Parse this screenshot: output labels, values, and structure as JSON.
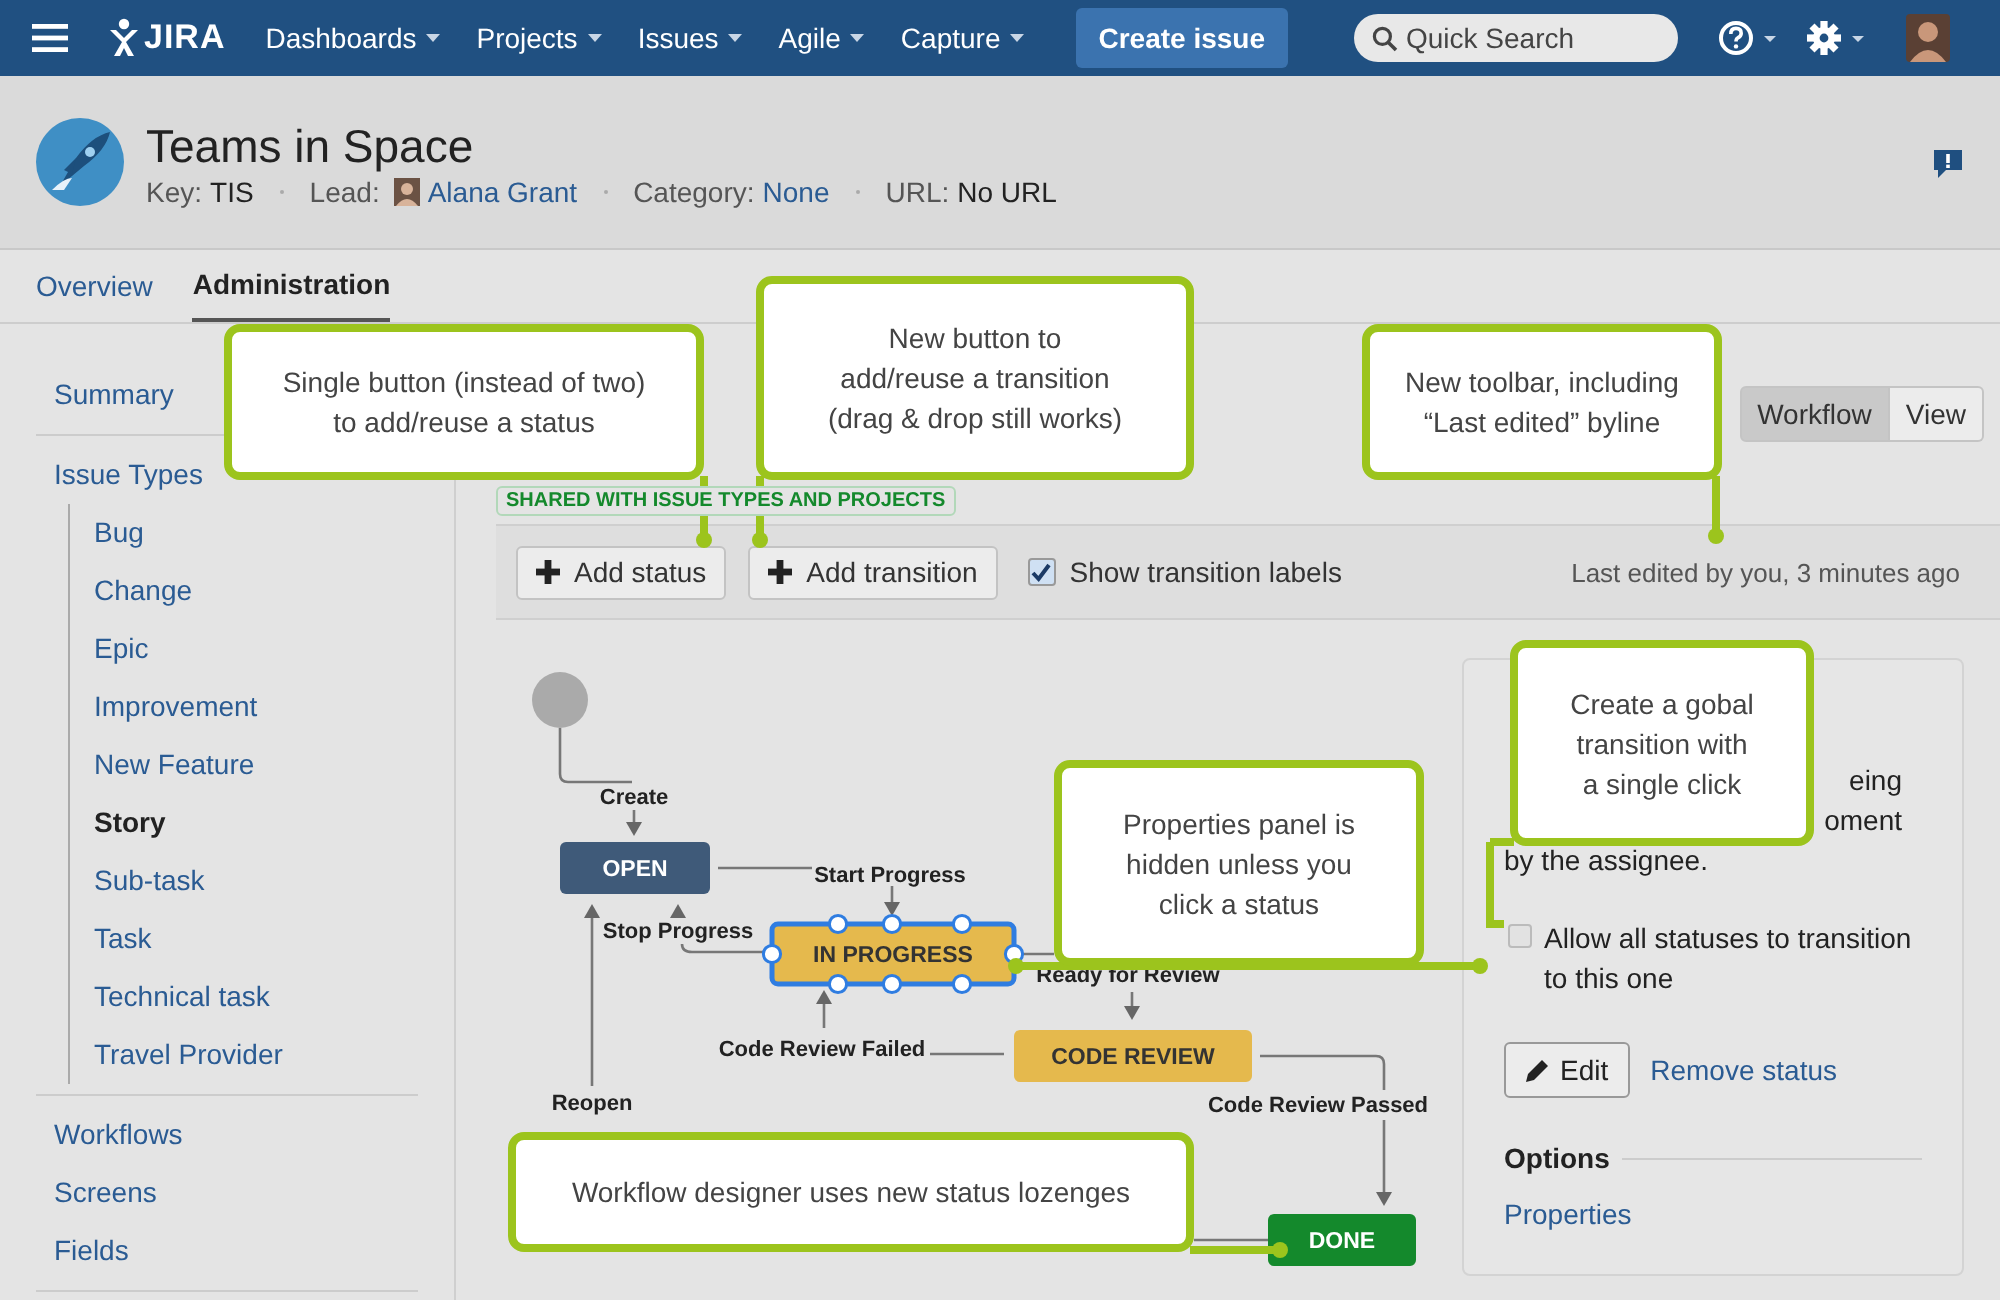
{
  "nav": {
    "logo": "JIRA",
    "menu_items": [
      {
        "label": "Dashboards"
      },
      {
        "label": "Projects"
      },
      {
        "label": "Issues"
      },
      {
        "label": "Agile"
      },
      {
        "label": "Capture"
      }
    ],
    "create_button": "Create issue",
    "search": {
      "placeholder": "Quick Search"
    }
  },
  "project": {
    "name": "Teams in Space",
    "key_label": "Key:",
    "key": "TIS",
    "lead_label": "Lead:",
    "lead": "Alana Grant",
    "category_label": "Category:",
    "category": "None",
    "url_label": "URL:",
    "url": "No URL"
  },
  "tabs": [
    {
      "label": "Overview",
      "selected": false
    },
    {
      "label": "Administration",
      "selected": true
    }
  ],
  "sidebar": {
    "groups": [
      {
        "items": [
          {
            "label": "Summary",
            "selected": false
          }
        ]
      },
      {
        "items": [
          {
            "label": "Issue Types",
            "selected": false,
            "children": [
              {
                "label": "Bug",
                "selected": false
              },
              {
                "label": "Change",
                "selected": false
              },
              {
                "label": "Epic",
                "selected": false
              },
              {
                "label": "Improvement",
                "selected": false
              },
              {
                "label": "New Feature",
                "selected": false
              },
              {
                "label": "Story",
                "selected": true
              },
              {
                "label": "Sub-task",
                "selected": false
              },
              {
                "label": "Task",
                "selected": false
              },
              {
                "label": "Technical task",
                "selected": false
              },
              {
                "label": "Travel Provider",
                "selected": false
              }
            ]
          }
        ]
      },
      {
        "items": [
          {
            "label": "Workflows",
            "selected": false
          },
          {
            "label": "Screens",
            "selected": false
          },
          {
            "label": "Fields",
            "selected": false
          }
        ]
      }
    ]
  },
  "workflow": {
    "shared_lozenge": "SHARED WITH ISSUE TYPES AND PROJECTS",
    "view_toggle": [
      {
        "label": "Workflow",
        "selected": true
      },
      {
        "label": "View",
        "selected": false
      }
    ]
  },
  "toolbar": {
    "buttons": [
      {
        "label": "Add status"
      },
      {
        "label": "Add transition"
      }
    ],
    "show_labels": {
      "label": "Show transition labels",
      "checked": true
    },
    "last_edited": "Last edited by you, 3 minutes ago"
  },
  "diagram": {
    "statuses": [
      {
        "name": "OPEN",
        "color": "#3f5a79",
        "selected": false
      },
      {
        "name": "IN PROGRESS",
        "color": "#e5b94d",
        "selected": true
      },
      {
        "name": "CODE REVIEW",
        "color": "#e5b94d",
        "selected": false
      },
      {
        "name": "DONE",
        "color": "#14892c",
        "selected": false
      }
    ],
    "transitions": [
      {
        "label": "Create"
      },
      {
        "label": "Start Progress"
      },
      {
        "label": "Stop Progress"
      },
      {
        "label": "Ready for Review"
      },
      {
        "label": "Code Review Failed"
      },
      {
        "label": "Reopen"
      },
      {
        "label": "Code Review Passed"
      }
    ]
  },
  "panel": {
    "description_rows": [
      {
        "end": "eing"
      },
      {
        "end": "oment"
      },
      {
        "start": "by the assignee."
      }
    ],
    "global_transition": {
      "label": "Allow all statuses to transition to this one",
      "checked": false
    },
    "edit_button": "Edit",
    "remove_link": "Remove status",
    "options_heading": "Options",
    "options_links": [
      "Properties"
    ]
  },
  "callouts": [
    {
      "text": "Single button (instead of two)\nto add/reuse a status"
    },
    {
      "text": "New button to\nadd/reuse a transition\n(drag & drop still works)"
    },
    {
      "text": "New toolbar, including\n“Last edited” byline"
    },
    {
      "text": "Properties panel is\nhidden unless you\nclick a status"
    },
    {
      "text": "Create a gobal\ntransition with\na single click"
    },
    {
      "text": "Workflow designer uses new status lozenges"
    }
  ]
}
